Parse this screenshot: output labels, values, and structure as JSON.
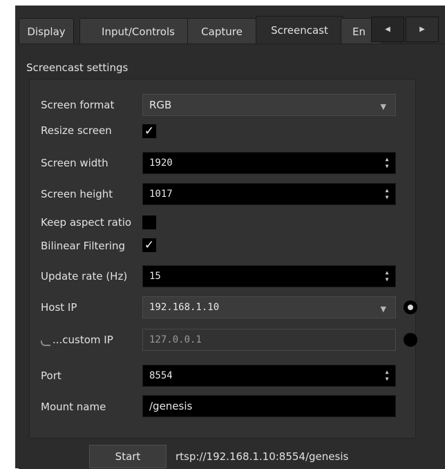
{
  "tabs": [
    {
      "label": "Display"
    },
    {
      "label": "Input/Controls"
    },
    {
      "label": "Capture"
    },
    {
      "label": "Screencast",
      "active": true
    },
    {
      "label": "En"
    }
  ],
  "tab_scroll": {
    "left_icon": "◀",
    "right_icon": "▶"
  },
  "pane_title": "Screencast settings",
  "settings": {
    "screen_format": {
      "label": "Screen format",
      "value": "RGB"
    },
    "resize_screen": {
      "label": "Resize screen",
      "checked": true,
      "mark": "✓"
    },
    "screen_width": {
      "label": "Screen width",
      "value": "1920"
    },
    "screen_height": {
      "label": "Screen height",
      "value": "1017"
    },
    "keep_aspect_ratio": {
      "label": "Keep aspect ratio",
      "checked": false,
      "mark": ""
    },
    "bilinear_filtering": {
      "label": "Bilinear Filtering",
      "checked": true,
      "mark": "✓"
    },
    "update_rate": {
      "label": "Update rate (Hz)",
      "value": "15"
    },
    "host_ip": {
      "label": "Host IP",
      "value": "192.168.1.10",
      "selected": true
    },
    "custom_ip": {
      "label": "...custom IP",
      "value": "127.0.0.1",
      "selected": false
    },
    "port": {
      "label": "Port",
      "value": "8554"
    },
    "mount_name": {
      "label": "Mount name",
      "value": "/genesis"
    }
  },
  "start_button": {
    "label": "Start"
  },
  "stream_url": "rtsp://192.168.1.10:8554/genesis",
  "icons": {
    "dropdown": "▼",
    "spin": "▲▼"
  }
}
